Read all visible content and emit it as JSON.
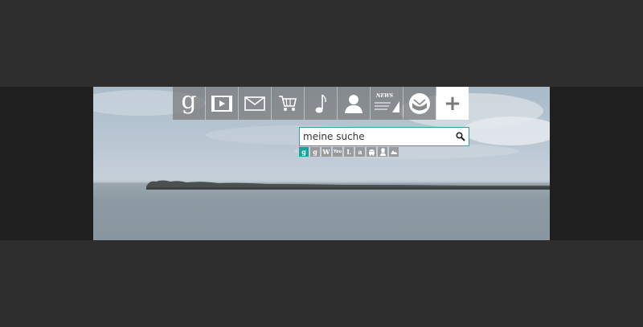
{
  "nav": {
    "tiles": [
      {
        "name": "google-tile",
        "icon": "google-g-icon",
        "glyph": "g"
      },
      {
        "name": "video-tile",
        "icon": "film-play-icon"
      },
      {
        "name": "mail-tile",
        "icon": "envelope-icon"
      },
      {
        "name": "shopping-tile",
        "icon": "shopping-cart-icon"
      },
      {
        "name": "music-tile",
        "icon": "music-note-icon"
      },
      {
        "name": "people-tile",
        "icon": "person-icon"
      },
      {
        "name": "news-tile",
        "icon": "news-icon",
        "label": "NEWS"
      },
      {
        "name": "mail-app-tile",
        "icon": "inbox-circle-icon"
      },
      {
        "name": "add-tile",
        "icon": "plus-icon",
        "glyph": "+"
      }
    ]
  },
  "search": {
    "value": "meine suche",
    "button_icon": "search-icon"
  },
  "engines": [
    {
      "icon": "google-icon",
      "glyph": "g",
      "active": true
    },
    {
      "icon": "google-images-icon",
      "glyph": "g"
    },
    {
      "icon": "wikipedia-icon",
      "glyph": "W"
    },
    {
      "icon": "youtube-icon",
      "glyph": "You"
    },
    {
      "icon": "book-icon",
      "glyph": "L"
    },
    {
      "icon": "amazon-icon",
      "glyph": "a"
    },
    {
      "icon": "android-icon"
    },
    {
      "icon": "chef-icon"
    },
    {
      "icon": "weather-icon"
    }
  ],
  "colors": {
    "page_bg": "#2e2e2e",
    "band_bg": "#1f1f1f",
    "tile_bg": "#787878",
    "accent": "#1aa39a",
    "engine_bg": "#9a9a9a"
  }
}
